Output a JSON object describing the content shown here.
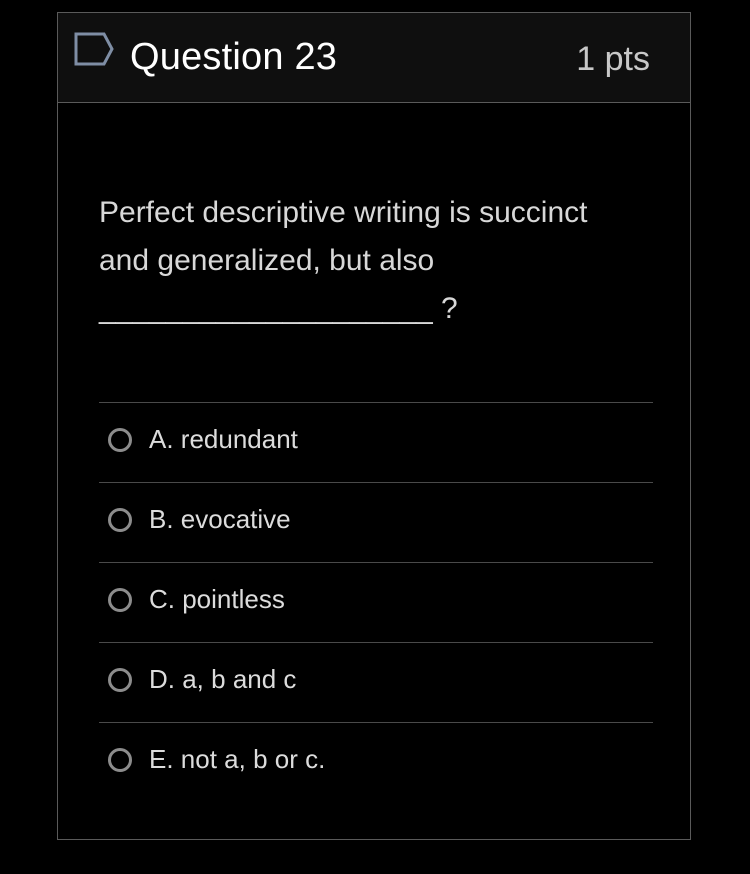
{
  "question": {
    "title": "Question 23",
    "points": "1 pts",
    "flag_icon": "flag-outline-icon",
    "text_lines": [
      "Perfect descriptive writing is succinct",
      "and generalized, but also",
      "____________________ ?"
    ]
  },
  "answers": [
    {
      "label": "A. redundant",
      "selected": false
    },
    {
      "label": "B. evocative",
      "selected": false
    },
    {
      "label": "C. pointless",
      "selected": false
    },
    {
      "label": "D. a, b and c",
      "selected": false
    },
    {
      "label": "E. not a, b or c.",
      "selected": false
    }
  ],
  "colors": {
    "background": "#000000",
    "header_background": "#0f0f0f",
    "border": "#5a5a5a",
    "text_primary": "#ffffff",
    "text_secondary": "#d8d8d8",
    "radio_border": "#8c8c8c",
    "flag_border": "#7f8ea5"
  }
}
